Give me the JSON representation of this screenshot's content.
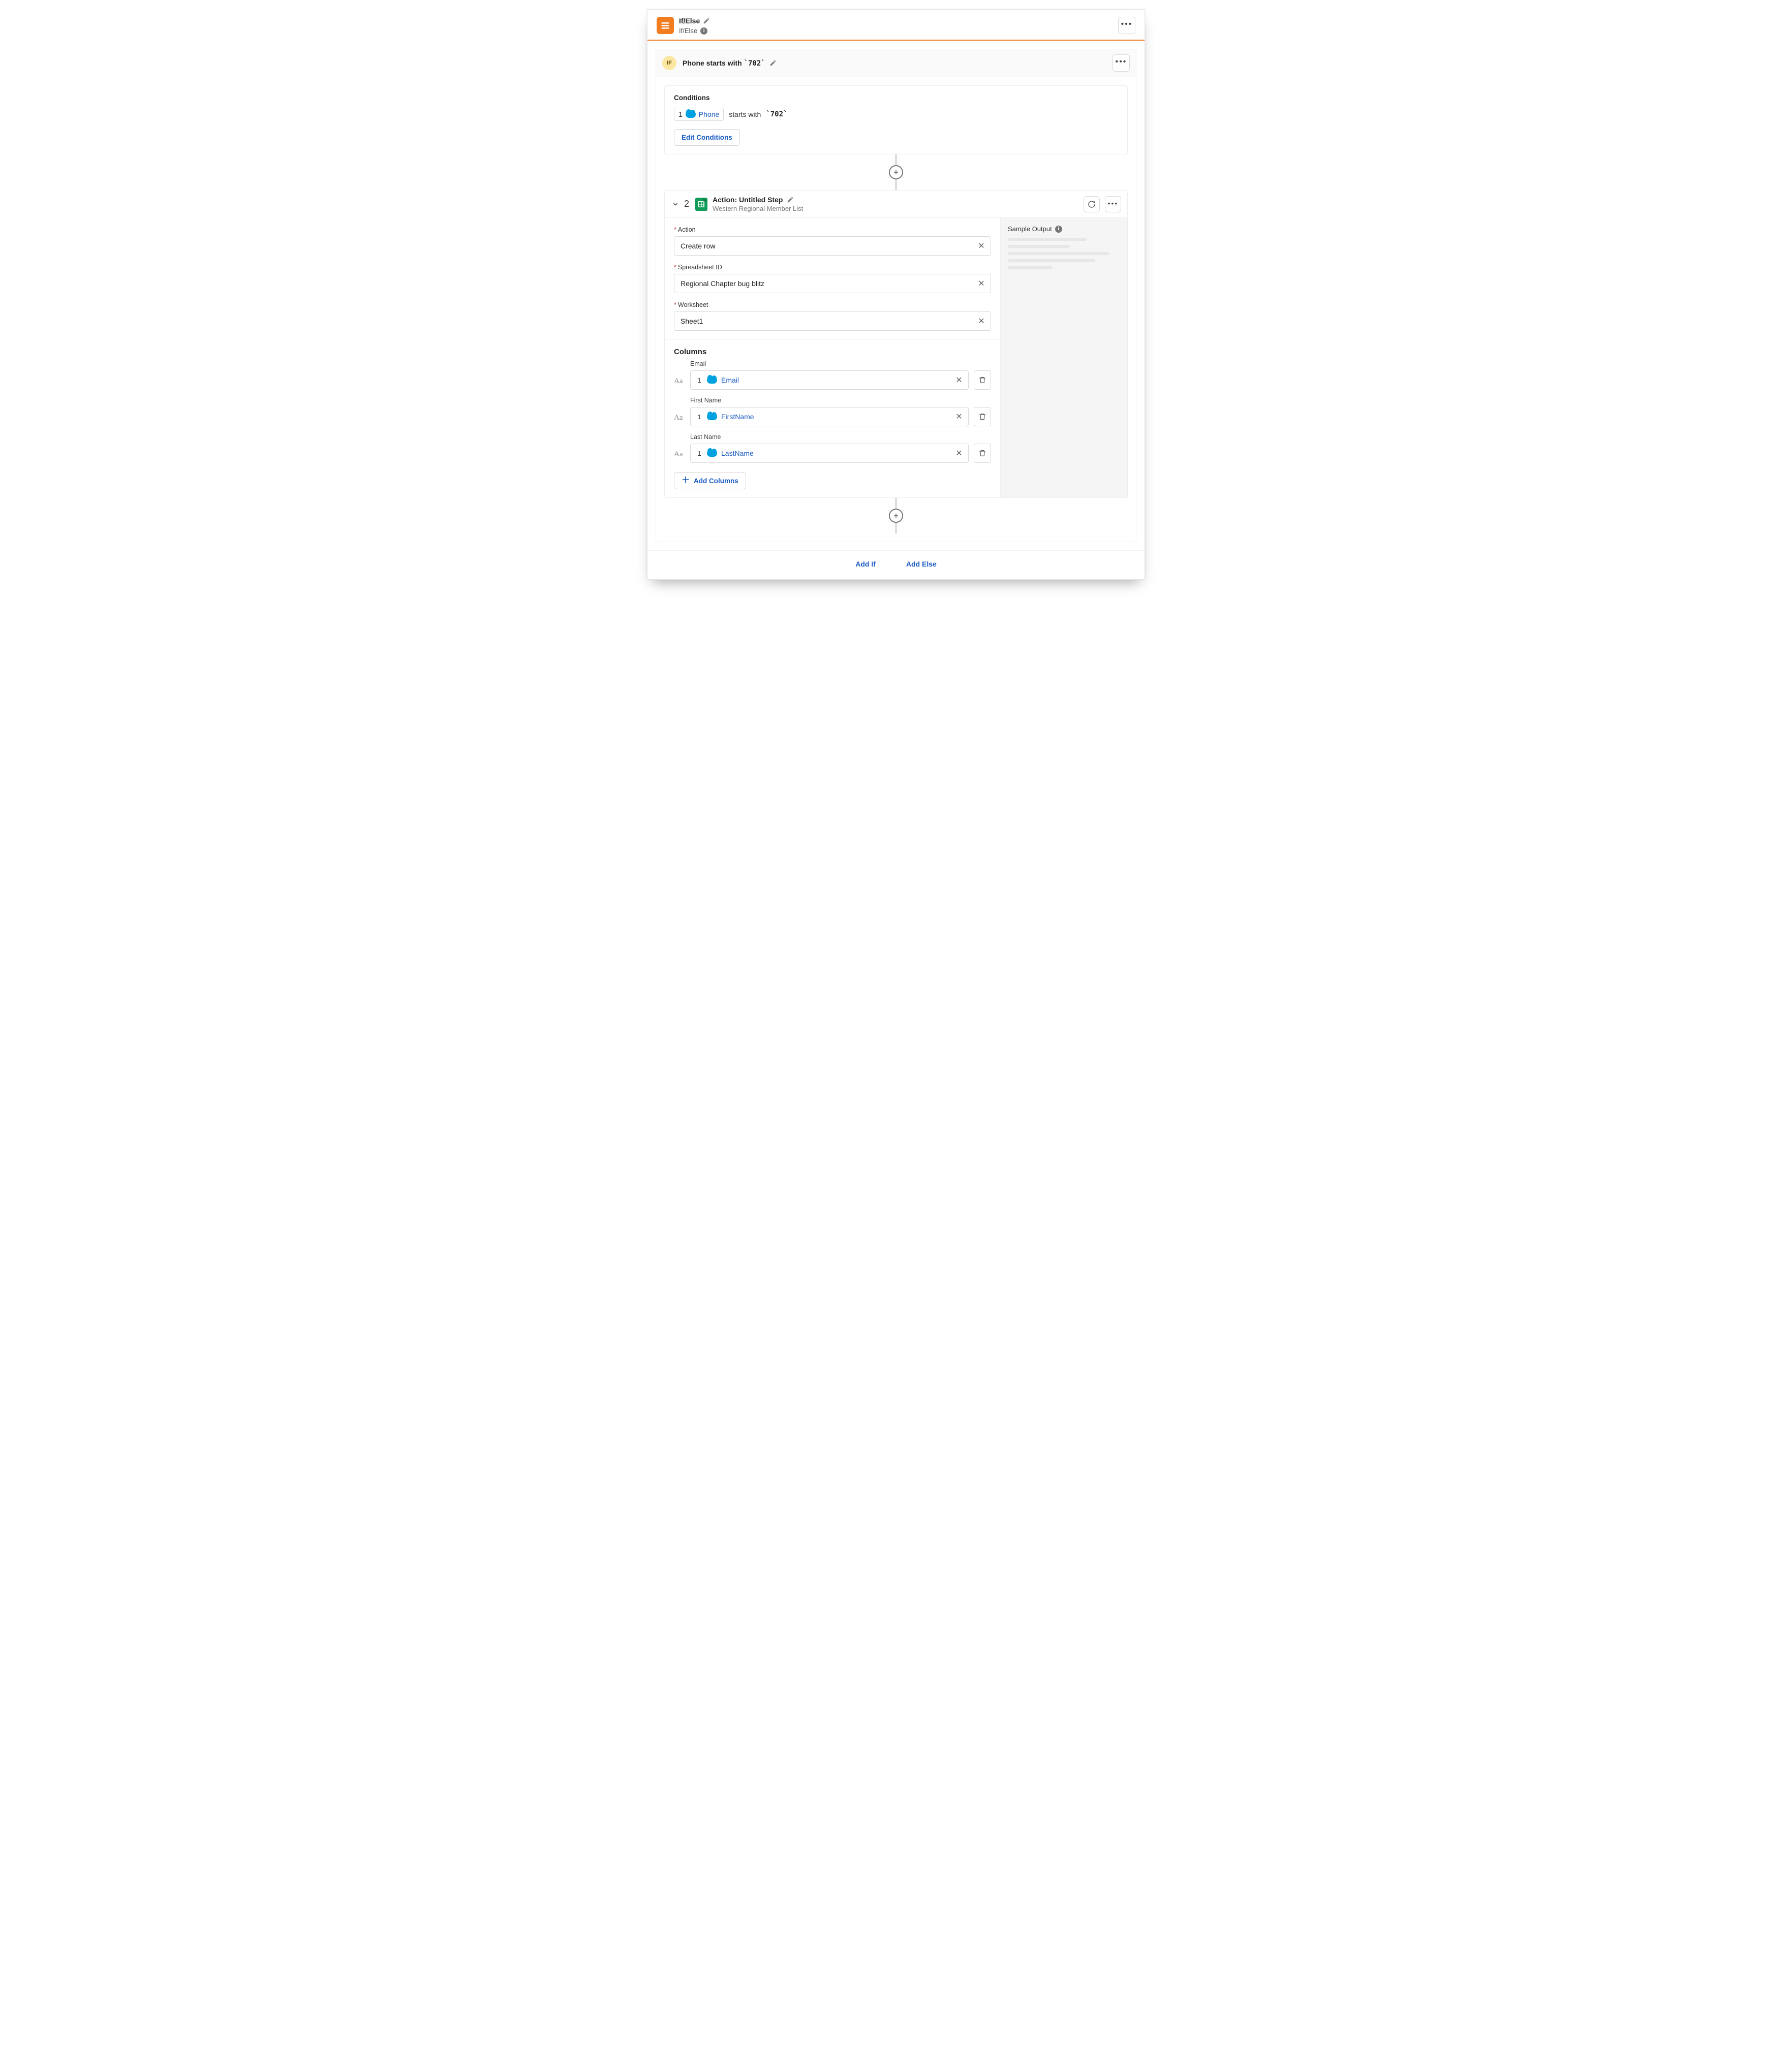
{
  "node": {
    "title": "If/Else",
    "subtype": "If/Else"
  },
  "if_branch": {
    "badge": "IF",
    "title_prefix": "Phone starts with",
    "title_value": "`702`",
    "conditions": {
      "heading": "Conditions",
      "index": "1",
      "field": "Phone",
      "operator": "starts with",
      "value": "`702`",
      "edit_label": "Edit Conditions"
    }
  },
  "action_step": {
    "step_number": "2",
    "title": "Action: Untitled Step",
    "subtitle": "Western Regional Member List",
    "fields": {
      "action": {
        "label": "Action",
        "value": "Create row"
      },
      "spreadsheet_id": {
        "label": "Spreadsheet ID",
        "value": "Regional Chapter bug blitz"
      },
      "worksheet": {
        "label": "Worksheet",
        "value": "Sheet1"
      }
    },
    "columns_heading": "Columns",
    "columns": [
      {
        "label": "Email",
        "index": "1",
        "token": "Email"
      },
      {
        "label": "First Name",
        "index": "1",
        "token": "FirstName"
      },
      {
        "label": "Last Name",
        "index": "1",
        "token": "LastName"
      }
    ],
    "add_columns_label": "Add Columns",
    "sample_output_label": "Sample Output"
  },
  "footer": {
    "add_if": "Add If",
    "add_else": "Add Else"
  },
  "type_glyph": "Aa"
}
